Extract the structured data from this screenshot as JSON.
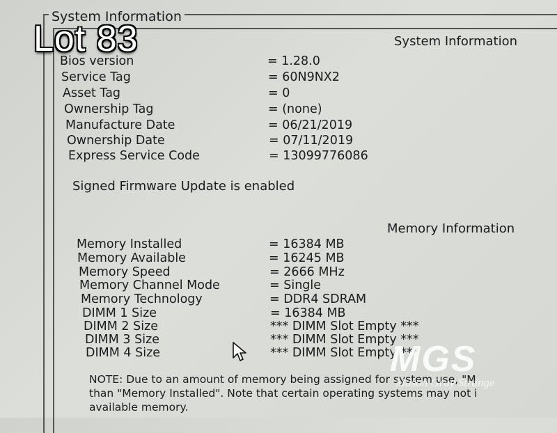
{
  "overlay": {
    "lot": "Lot 83"
  },
  "frame": {
    "title": "System Information"
  },
  "system": {
    "heading": "System Information",
    "rows": [
      {
        "label": "Bios version",
        "value": "= 1.28.0"
      },
      {
        "label": "Service Tag",
        "value": "= 60N9NX2"
      },
      {
        "label": "Asset Tag",
        "value": "= 0"
      },
      {
        "label": "Ownership Tag",
        "value": "= (none)"
      },
      {
        "label": "Manufacture Date",
        "value": "= 06/21/2019"
      },
      {
        "label": "Ownership Date",
        "value": "= 07/11/2019"
      },
      {
        "label": "Express Service Code",
        "value": "= 13099776086"
      }
    ],
    "firmware_status": "Signed Firmware Update is enabled"
  },
  "memory": {
    "heading": "Memory Information",
    "rows": [
      {
        "label": "Memory Installed",
        "value": "= 16384 MB"
      },
      {
        "label": "Memory Available",
        "value": "= 16245 MB"
      },
      {
        "label": "Memory Speed",
        "value": "= 2666 MHz"
      },
      {
        "label": "Memory Channel Mode",
        "value": "= Single"
      },
      {
        "label": "Memory Technology",
        "value": "= DDR4 SDRAM"
      },
      {
        "label": "DIMM 1 Size",
        "value": "= 16384 MB"
      },
      {
        "label": "DIMM 2 Size",
        "value": "*** DIMM Slot Empty ***"
      },
      {
        "label": "DIMM 3 Size",
        "value": "*** DIMM Slot Empty ***"
      },
      {
        "label": "DIMM 4 Size",
        "value": "*** DIMM Slot Empty ***"
      }
    ],
    "note_lines": [
      "NOTE: Due to an amount of memory being assigned for system use, \"M",
      "than \"Memory Installed\". Note that certain operating systems may not i",
      "available memory."
    ]
  },
  "watermark": {
    "logo": "MGS",
    "name": "Mason Gray Strange"
  }
}
